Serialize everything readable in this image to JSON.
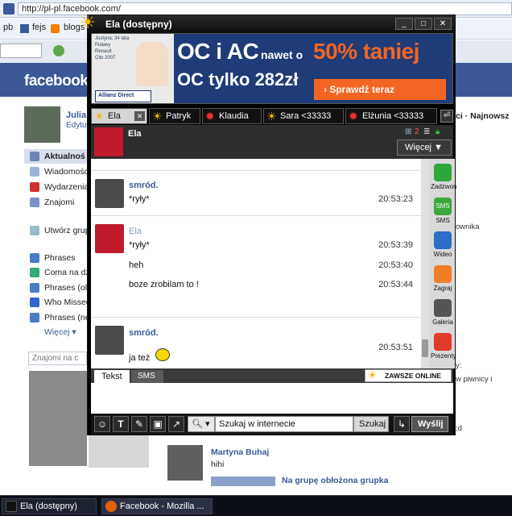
{
  "browser": {
    "url": "http://pl-pl.facebook.com/",
    "bookmarks": [
      "pb",
      "fejs",
      "blogs"
    ]
  },
  "facebook": {
    "logo": "facebook",
    "user_name": "Julia",
    "user_edit": "Edytu",
    "nav": [
      "Aktualnoś",
      "Wiadomości",
      "Wydarzenia",
      "Znajomi",
      "Utwórz grup",
      "Phrases",
      "Coma na dzi",
      "Phrases (olc",
      "Who Missed",
      "Phrases (ne",
      "Więcej ▾"
    ],
    "search_friends": "Znajomi na c",
    "right_snippets": [
      "ci · Najnowsz",
      "ownika",
      "y:",
      "w piwnicy i",
      ";d"
    ],
    "post_author": "Martyna Buhaj",
    "post_text": "hihi",
    "post_link": "Na grupę obłożona grupka"
  },
  "chat": {
    "title": "Ela (dostępny)",
    "ad": {
      "small_text": [
        "Justyna, 34 lata",
        "Puławy",
        "Renault",
        "Clio 2007"
      ],
      "brand": "Allianz Direct",
      "headline1": "OC i AC",
      "headline1b": "nawet o",
      "headline1c": "50% taniej",
      "headline2": "OC tylko 282zł",
      "cta": "› Sprawdź teraz"
    },
    "tabs": [
      "Ela",
      "Patryk",
      "Klaudia",
      "Sara <33333",
      "Elżunia <33333"
    ],
    "contact_name": "Ela",
    "badge_count": "2",
    "more_button": "Więcej ▼",
    "messages": [
      {
        "sender": "smród.",
        "lines": [
          {
            "text": "*ryły*",
            "time": "20:53:23"
          }
        ]
      },
      {
        "sender": "Ela",
        "lines": [
          {
            "text": "*ryły*",
            "time": "20:53:39"
          },
          {
            "text": "heh",
            "time": "20:53:40"
          },
          {
            "text": "boze zrobilam to !",
            "time": "20:53:44"
          }
        ]
      },
      {
        "sender": "smród.",
        "lines": [
          {
            "text": "ja też",
            "time": "20:53:51"
          }
        ]
      }
    ],
    "side_actions": [
      "Zadzwoń",
      "SMS",
      "Wideo",
      "Zagraj",
      "Galeria",
      "Prezenty"
    ],
    "input_tabs": [
      "Tekst",
      "SMS"
    ],
    "always_online": "ZAWSZE ONLINE",
    "search_placeholder": "Szukaj w internecie",
    "search_button": "Szukaj",
    "send_button": "Wyślij"
  },
  "taskbar": [
    "Ela (dostępny)",
    "Facebook - Mozilla ..."
  ],
  "colors": {
    "fb_blue": "#3b5998",
    "ad_orange": "#f26522",
    "chat_bg": "#000000",
    "sms_green": "#3aa83a"
  }
}
